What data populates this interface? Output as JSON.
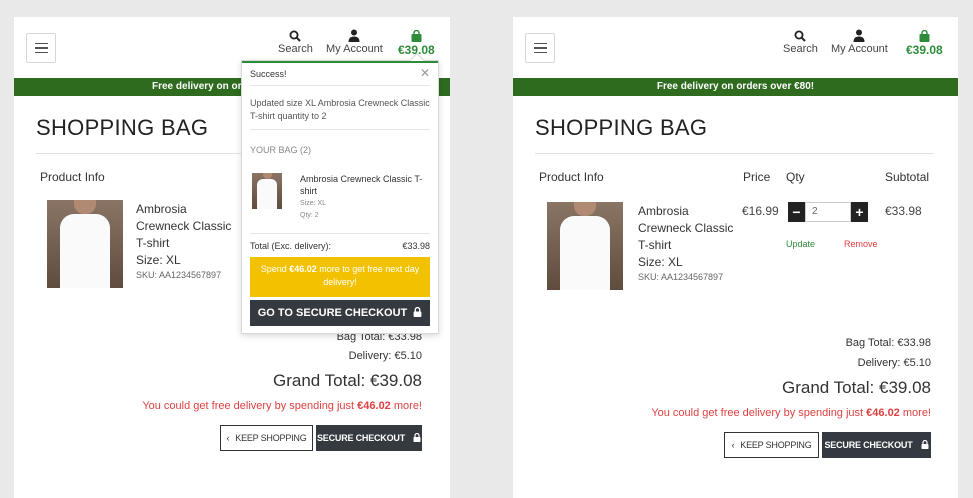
{
  "nav": {
    "search_label": "Search",
    "account_label": "My Account",
    "bag_total": "€39.08"
  },
  "banner": {
    "left_text": "Free delivery on or",
    "right_text": "Free delivery on orders over €80!"
  },
  "page_title": "SHOPPING BAG",
  "table": {
    "product_info": "Product Info",
    "price": "Price",
    "qty": "Qty",
    "subtotal": "Subtotal"
  },
  "product": {
    "name_lines": [
      "Ambrosia",
      "Crewneck Classic",
      "T-shirt"
    ],
    "size_label": "Size:",
    "size_value": "XL",
    "sku": "SKU: AA1234567897",
    "price": "€16.99",
    "qty_value": "2",
    "subtotal": "€33.98",
    "update_label": "Update",
    "remove_label": "Remove"
  },
  "totals": {
    "bag_total": "Bag Total: €33.98",
    "delivery": "Delivery: €5.10",
    "grand_total": "Grand Total: €39.08",
    "free_delivery_prefix": "You could get free delivery by spending just ",
    "free_delivery_amount": "€46.02",
    "free_delivery_suffix": " more!"
  },
  "buttons": {
    "keep_shopping": "KEEP SHOPPING",
    "secure_checkout": "SECURE CHECKOUT"
  },
  "popup": {
    "header": "Success!",
    "message": "Updated size XL Ambrosia Crewneck Classic T-shirt quantity to 2",
    "bag_heading": "YOUR BAG (2)",
    "item_name": "Ambrosia Crewneck Classic T-shirt",
    "item_size": "Size: XL",
    "item_qty": "Qty: 2",
    "total_label": "Total (Exc. delivery):",
    "total_value": "€33.98",
    "spend_prefix": "Spend ",
    "spend_amount": "€46.02",
    "spend_suffix": " more to get free next day delivery!",
    "checkout_label": "GO TO SECURE CHECKOUT"
  },
  "colors": {
    "brand_green": "#2e6b1e",
    "bag_green": "#2e8b3a",
    "alert_red": "#e04040",
    "promo_yellow": "#f2c200",
    "dark_button": "#353a40"
  },
  "icons": [
    "hamburger-menu-icon",
    "search-icon",
    "user-icon",
    "shopping-bag-icon",
    "close-icon",
    "chevron-left-icon",
    "lock-icon",
    "minus-icon",
    "plus-icon"
  ]
}
